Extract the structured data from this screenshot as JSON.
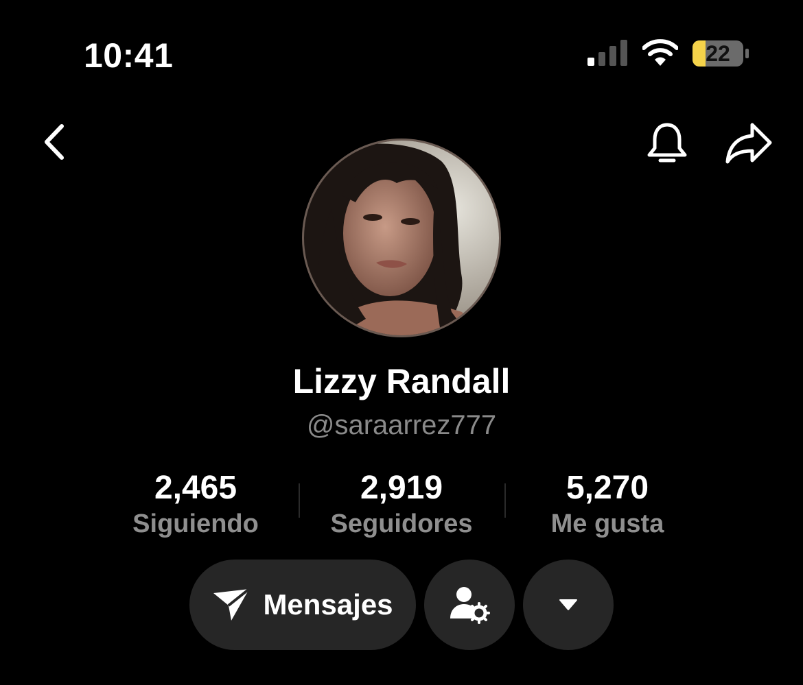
{
  "status_bar": {
    "time": "10:41",
    "battery_level": "22",
    "battery_color": "#F5D34A"
  },
  "nav": {
    "back_icon": "chevron-left-icon",
    "bell_icon": "bell-icon",
    "share_icon": "share-arrow-icon"
  },
  "profile": {
    "display_name": "Lizzy Randall",
    "handle": "@saraarrez777"
  },
  "stats": [
    {
      "value": "2,465",
      "label": "Siguiendo"
    },
    {
      "value": "2,919",
      "label": "Seguidores"
    },
    {
      "value": "5,270",
      "label": "Me gusta"
    }
  ],
  "actions": {
    "messages_label": "Mensajes",
    "messages_icon": "send-icon",
    "friends_icon": "user-settings-icon",
    "more_icon": "caret-down-icon"
  },
  "colors": {
    "background": "#000000",
    "button_bg": "#262626",
    "secondary_text": "#8A8A8A"
  }
}
